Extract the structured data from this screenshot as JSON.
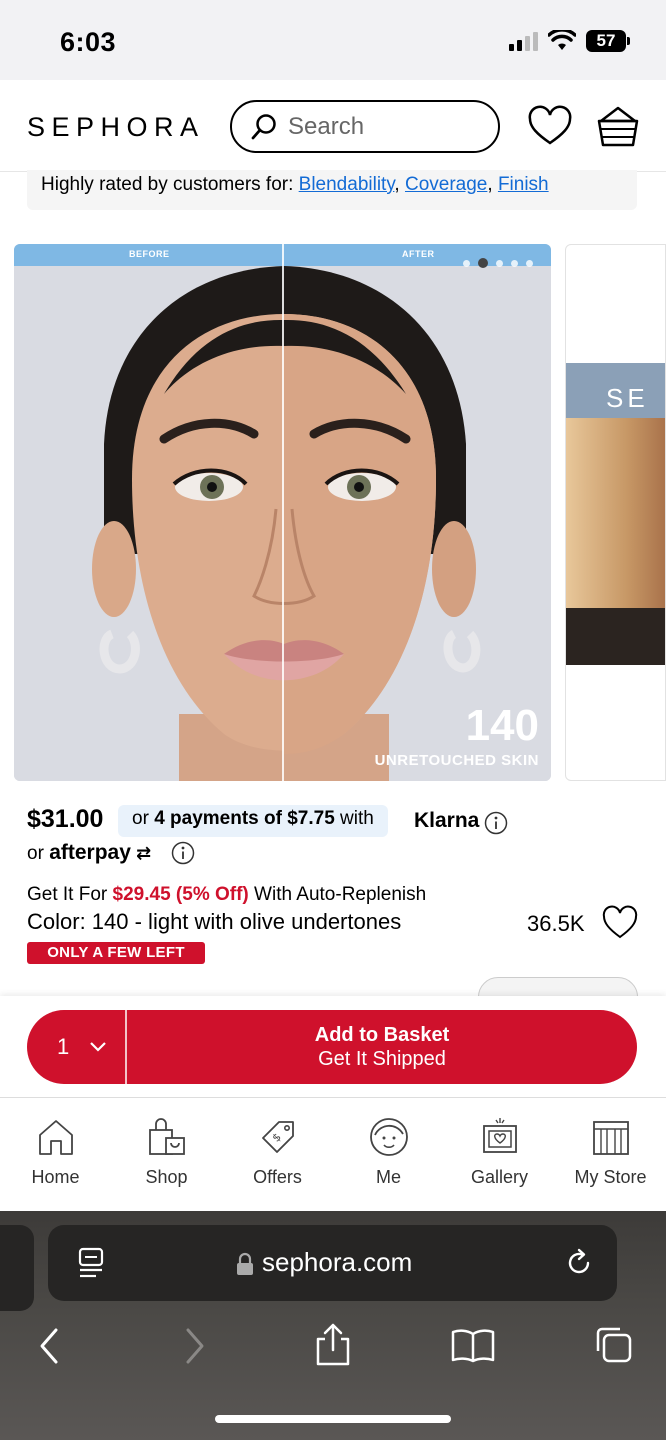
{
  "status_bar": {
    "time": "6:03",
    "battery": "57"
  },
  "header": {
    "logo": "SEPHORA",
    "search_placeholder": "Search"
  },
  "rated": {
    "prefix": "Highly rated by customers for: ",
    "links": [
      "Blendability",
      "Coverage",
      "Finish"
    ]
  },
  "hero": {
    "before_label": "BEFORE",
    "after_label": "AFTER",
    "shade": "140",
    "shade_caption": "UNRETOUCHED SKIN",
    "dots_count": 5,
    "active_dot": 1
  },
  "peek": {
    "text": "SE"
  },
  "pricing": {
    "price": "$31.00",
    "klarna_prefix": "or ",
    "klarna_bold": "4 payments of $7.75",
    "klarna_suffix": " with",
    "klarna_logo": "Klarna",
    "afterpay_prefix": "or ",
    "afterpay_logo": "afterpay"
  },
  "auto_replenish": {
    "prefix": "Get It For ",
    "deal": "$29.45 (5% Off)",
    "suffix": " With Auto-Replenish"
  },
  "product": {
    "color_label": "Color: 140 - light with olive undertones",
    "loves": "36.5K",
    "badge": "ONLY A FEW LEFT"
  },
  "basket": {
    "quantity": "1",
    "title": "Add to Basket",
    "subtitle": "Get It Shipped"
  },
  "nav": {
    "items": [
      {
        "label": "Home",
        "icon": "home-icon"
      },
      {
        "label": "Shop",
        "icon": "shop-icon"
      },
      {
        "label": "Offers",
        "icon": "offers-icon"
      },
      {
        "label": "Me",
        "icon": "me-icon"
      },
      {
        "label": "Gallery",
        "icon": "gallery-icon"
      },
      {
        "label": "My Store",
        "icon": "store-icon"
      }
    ]
  },
  "browser": {
    "url": "sephora.com"
  },
  "colors": {
    "brand_red": "#cf112c",
    "link_blue": "#136bd5",
    "klarna_bg": "#e9f2fb"
  }
}
